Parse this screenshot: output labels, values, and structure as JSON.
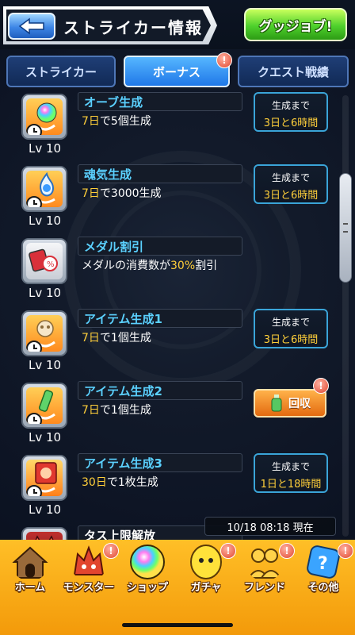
{
  "header": {
    "title": "ストライカー情報",
    "back_icon": "back-arrow-icon",
    "gj_button": "グッジョブ!"
  },
  "tabs": [
    {
      "label": "ストライカー",
      "active": false
    },
    {
      "label": "ボーナス",
      "active": true,
      "badge": "!"
    },
    {
      "label": "クエスト戦績",
      "active": false
    }
  ],
  "bonuses": [
    {
      "icon": "orb-generation-icon",
      "level": "Lv 10",
      "name": "オーブ生成",
      "desc_hl": "7日",
      "desc": "で5個生成",
      "status_l1": "生成まで",
      "status_l2": "3日と6時間"
    },
    {
      "icon": "soul-generation-icon",
      "level": "Lv 10",
      "name": "魂気生成",
      "desc_hl": "7日",
      "desc": "で3000生成",
      "status_l1": "生成まで",
      "status_l2": "3日と6時間"
    },
    {
      "icon": "medal-discount-icon",
      "level": "Lv 10",
      "name": "メダル割引",
      "desc_pre": "メダルの消費数が",
      "desc_hl": "30%",
      "desc": "割引"
    },
    {
      "icon": "item-generation-1-icon",
      "level": "Lv 10",
      "name": "アイテム生成1",
      "desc_hl": "7日",
      "desc": "で1個生成",
      "status_l1": "生成まで",
      "status_l2": "3日と6時間"
    },
    {
      "icon": "item-generation-2-icon",
      "level": "Lv 10",
      "name": "アイテム生成2",
      "desc_hl": "7日",
      "desc": "で1個生成",
      "collect_label": "回収",
      "collect_badge": "!"
    },
    {
      "icon": "item-generation-3-icon",
      "level": "Lv 10",
      "name": "アイテム生成3",
      "desc_hl": "30日",
      "desc": "で1枚生成",
      "status_l1": "生成まで",
      "status_l2": "1日と18時間"
    },
    {
      "icon": "limit-release-icon",
      "level": "",
      "name": "タス上限解放"
    }
  ],
  "timestamp": "10/18 08:18 現在",
  "nav": [
    {
      "label": "ホーム",
      "icon": "home-icon",
      "badge": ""
    },
    {
      "label": "モンスター",
      "icon": "monster-icon",
      "badge": "!"
    },
    {
      "label": "ショップ",
      "icon": "shop-orb-icon",
      "badge": ""
    },
    {
      "label": "ガチャ",
      "icon": "gacha-icon",
      "badge": "!"
    },
    {
      "label": "フレンド",
      "icon": "friends-icon",
      "badge": "!"
    },
    {
      "label": "その他",
      "icon": "other-icon",
      "badge": "!"
    }
  ],
  "colors": {
    "accent_blue": "#5bd1ff",
    "highlight_yellow": "#ffcf3a",
    "nav_orange": "#f39a0a",
    "badge_red": "#e0462e"
  }
}
